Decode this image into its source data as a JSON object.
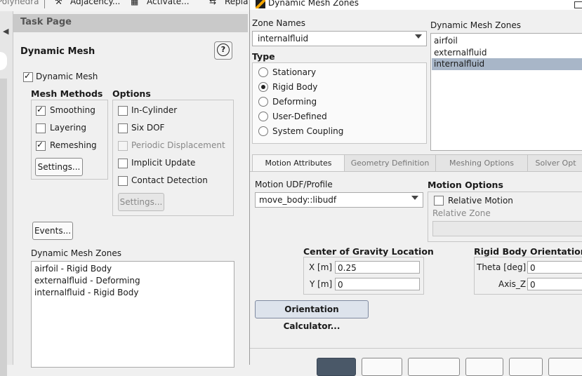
{
  "toolbar": {
    "items": [
      "Polyhedra",
      "Adjacency...",
      "Activate...",
      "Repla"
    ]
  },
  "task_page": {
    "header": "Task Page",
    "title": "Dynamic Mesh",
    "help_label": "?",
    "dynamic_mesh_checkbox": {
      "label": "Dynamic Mesh",
      "checked": true
    },
    "mesh_methods": {
      "heading": "Mesh Methods",
      "items": [
        {
          "label": "Smoothing",
          "checked": true
        },
        {
          "label": "Layering",
          "checked": false
        },
        {
          "label": "Remeshing",
          "checked": true
        }
      ],
      "settings_button": "Settings..."
    },
    "options": {
      "heading": "Options",
      "items": [
        {
          "label": "In-Cylinder",
          "checked": false,
          "enabled": true
        },
        {
          "label": "Six DOF",
          "checked": false,
          "enabled": true
        },
        {
          "label": "Periodic Displacement",
          "checked": false,
          "enabled": false
        },
        {
          "label": "Implicit Update",
          "checked": false,
          "enabled": true
        },
        {
          "label": "Contact Detection",
          "checked": false,
          "enabled": true
        }
      ],
      "settings_button": "Settings..."
    },
    "events_button": "Events...",
    "zones_label": "Dynamic Mesh Zones",
    "zones": [
      "airfoil - Rigid Body",
      "externalfluid - Deforming",
      "internalfluid - Rigid Body"
    ]
  },
  "dialog": {
    "title": "Dynamic Mesh Zones",
    "zone_names_label": "Zone Names",
    "zone_names_value": "internalfluid",
    "dynamic_zones_label": "Dynamic Mesh Zones",
    "dynamic_zones": [
      "airfoil",
      "externalfluid",
      "internalfluid"
    ],
    "selected_zone": "internalfluid",
    "type_label": "Type",
    "types": [
      {
        "label": "Stationary",
        "selected": false
      },
      {
        "label": "Rigid Body",
        "selected": true
      },
      {
        "label": "Deforming",
        "selected": false
      },
      {
        "label": "User-Defined",
        "selected": false
      },
      {
        "label": "System Coupling",
        "selected": false
      }
    ],
    "tabs": [
      "Motion Attributes",
      "Geometry Definition",
      "Meshing Options",
      "Solver Opt"
    ],
    "active_tab": "Motion Attributes",
    "motion_udf_label": "Motion UDF/Profile",
    "motion_udf_value": "move_body::libudf",
    "motion_options_label": "Motion Options",
    "relative_motion": {
      "label": "Relative Motion",
      "checked": false
    },
    "relative_zone_label": "Relative Zone",
    "relative_zone_value": "",
    "cog_label": "Center of Gravity Location",
    "cog_x_label": "X [m]",
    "cog_x_value": "0.25",
    "cog_y_label": "Y [m]",
    "cog_y_value": "0",
    "orientation_label": "Rigid Body Orientation",
    "theta_label": "Theta [deg]",
    "theta_value": "0",
    "axis_label": "Axis_Z",
    "axis_value": "0",
    "orientation_calc_button": "Orientation Calculator..."
  },
  "colors": {
    "selection": "#a8b6c8",
    "header": "#c9c9c9",
    "background": "#f0f0f0"
  }
}
